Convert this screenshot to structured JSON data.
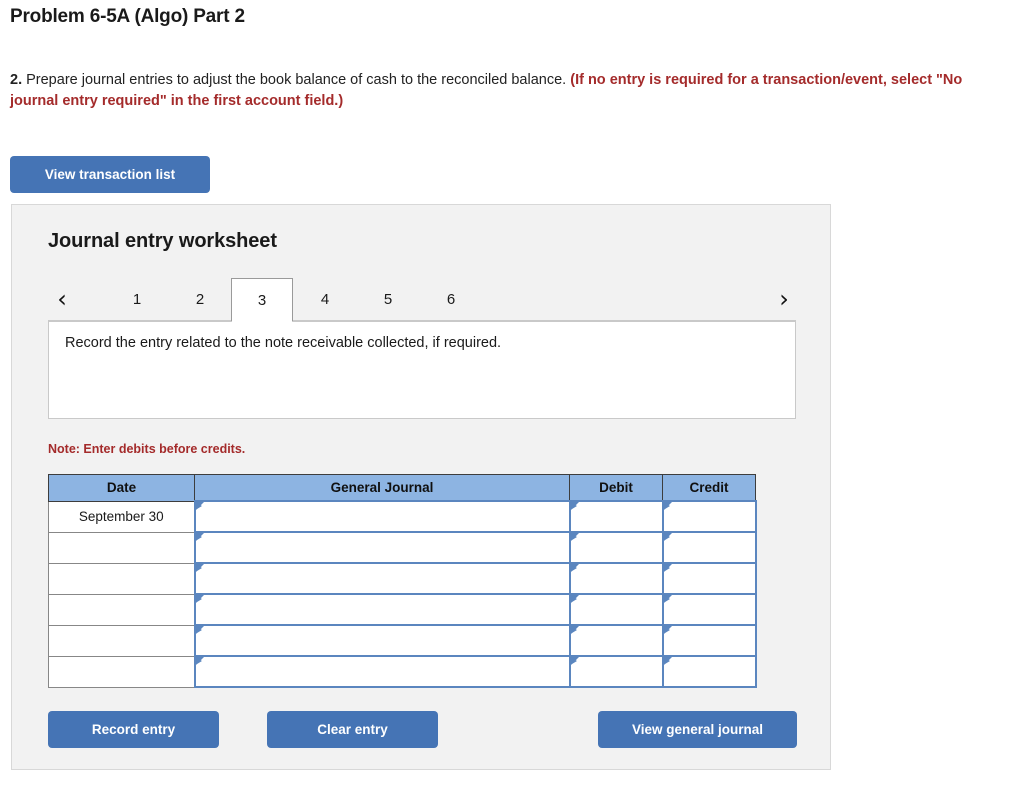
{
  "page": {
    "title": "Problem 6-5A (Algo) Part 2",
    "instruction": {
      "number": "2.",
      "body": " Prepare journal entries to adjust the book balance of cash to the reconciled balance. ",
      "emphasis": "(If no entry is required for a transaction/event, select \"No journal entry required\" in the first account field.)"
    }
  },
  "toolbar": {
    "view_transaction_list": "View transaction list"
  },
  "worksheet": {
    "title": "Journal entry worksheet",
    "nav": {
      "prev_icon": "chevron-left-icon",
      "prev_glyph": "‹",
      "next_icon": "chevron-right-icon",
      "next_glyph": "›"
    },
    "tabs": [
      {
        "label": "1",
        "active": false
      },
      {
        "label": "2",
        "active": false
      },
      {
        "label": "3",
        "active": true
      },
      {
        "label": "4",
        "active": false
      },
      {
        "label": "5",
        "active": false
      },
      {
        "label": "6",
        "active": false
      }
    ],
    "prompt": "Record the entry related to the note receivable collected, if required.",
    "note": "Note: Enter debits before credits.",
    "table": {
      "columns": [
        "Date",
        "General Journal",
        "Debit",
        "Credit"
      ],
      "rows": [
        {
          "date": "September 30",
          "general_journal": "",
          "debit": "",
          "credit": ""
        },
        {
          "date": "",
          "general_journal": "",
          "debit": "",
          "credit": ""
        },
        {
          "date": "",
          "general_journal": "",
          "debit": "",
          "credit": ""
        },
        {
          "date": "",
          "general_journal": "",
          "debit": "",
          "credit": ""
        },
        {
          "date": "",
          "general_journal": "",
          "debit": "",
          "credit": ""
        },
        {
          "date": "",
          "general_journal": "",
          "debit": "",
          "credit": ""
        }
      ]
    },
    "actions": {
      "record_entry": "Record entry",
      "clear_entry": "Clear entry",
      "view_general_journal": "View general journal"
    }
  },
  "colors": {
    "button_blue": "#4574b5",
    "header_blue": "#8db4e2",
    "input_border_blue": "#5b86bf",
    "accent_red": "#a42b2b",
    "panel_bg": "#f2f2f2"
  }
}
